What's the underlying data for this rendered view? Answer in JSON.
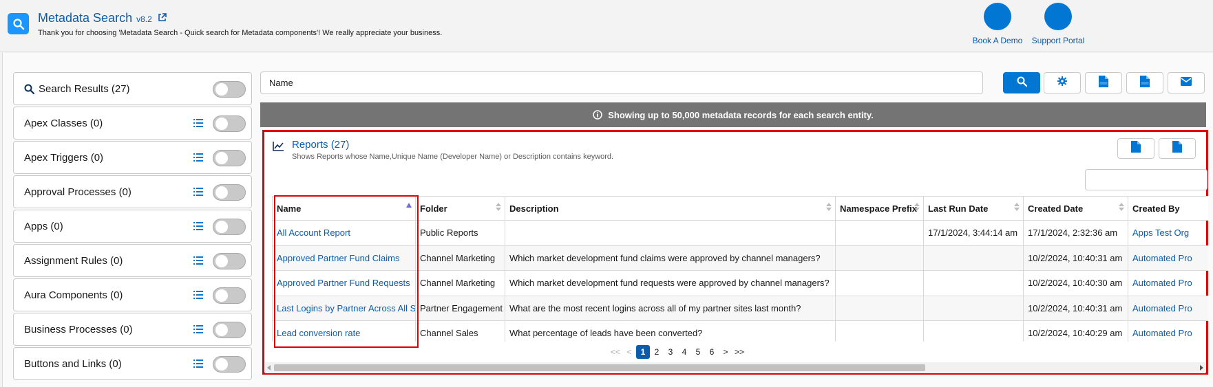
{
  "header": {
    "title": "Metadata Search",
    "version": "v8.2",
    "subtitle": "Thank you for choosing 'Metadata Search - Quick search for Metadata components'! We really appreciate your business.",
    "actions": [
      {
        "label": "Book A Demo"
      },
      {
        "label": "Support Portal"
      }
    ]
  },
  "sidebar": {
    "items": [
      {
        "label": "Search Results (27)"
      },
      {
        "label": "Apex Classes (0)"
      },
      {
        "label": "Apex Triggers (0)"
      },
      {
        "label": "Approval Processes (0)"
      },
      {
        "label": "Apps (0)"
      },
      {
        "label": "Assignment Rules (0)"
      },
      {
        "label": "Aura Components (0)"
      },
      {
        "label": "Business Processes (0)"
      },
      {
        "label": "Buttons and Links (0)"
      }
    ]
  },
  "search": {
    "value": "Name"
  },
  "toolbar": {
    "buttons": [
      "search-icon",
      "gear-icon",
      "pdf-icon",
      "csv-icon",
      "mail-icon"
    ]
  },
  "info": {
    "text": "Showing up to 50,000 metadata records for each search entity."
  },
  "reports": {
    "title": "Reports (27)",
    "description": "Shows Reports whose Name,Unique Name (Developer Name) or Description contains keyword.",
    "columns": [
      "Name",
      "Folder",
      "Description",
      "Namespace Prefix",
      "Last Run Date",
      "Created Date",
      "Created By"
    ],
    "rows": [
      [
        "All Account Report",
        "Public Reports",
        "",
        "",
        "17/1/2024, 3:44:14 am",
        "17/1/2024, 2:32:36 am",
        "Apps Test Org"
      ],
      [
        "Approved Partner Fund Claims",
        "Channel Marketing",
        "Which market development fund claims were approved by channel managers?",
        "",
        "",
        "10/2/2024, 10:40:31 am",
        "Automated Pro"
      ],
      [
        "Approved Partner Fund Requests",
        "Channel Marketing",
        "Which market development fund requests were approved by channel managers?",
        "",
        "",
        "10/2/2024, 10:40:30 am",
        "Automated Pro"
      ],
      [
        "Last Logins by Partner Across All Sites",
        "Partner Engagement",
        "What are the most recent logins across all of my partner sites last month?",
        "",
        "",
        "10/2/2024, 10:40:31 am",
        "Automated Pro"
      ],
      [
        "Lead conversion rate",
        "Channel Sales",
        "What percentage of leads have been converted?",
        "",
        "",
        "10/2/2024, 10:40:29 am",
        "Automated Pro"
      ]
    ],
    "pagination": {
      "first": "<<",
      "prev": "<",
      "pages": [
        "1",
        "2",
        "3",
        "4",
        "5",
        "6"
      ],
      "current": "1",
      "next": ">",
      "last": ">>"
    }
  },
  "colors": {
    "brand": "#0176d3",
    "link": "#0b5cab",
    "highlight": "#e00000",
    "info_bar": "#747474"
  }
}
